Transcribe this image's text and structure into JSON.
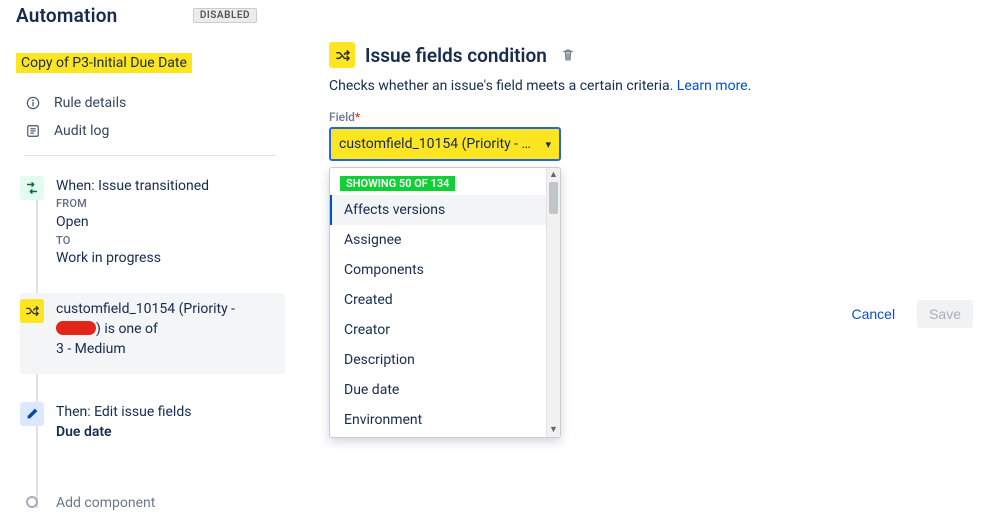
{
  "automation": {
    "page_title": "Automation",
    "status_badge": "DISABLED",
    "rule_name": "Copy of P3-Initial Due Date",
    "nav": {
      "rule_details": "Rule details",
      "audit_log": "Audit log"
    },
    "steps": {
      "trigger": {
        "title": "When: Issue transitioned",
        "from_label": "FROM",
        "from_value": "Open",
        "to_label": "TO",
        "to_value": "Work in progress"
      },
      "condition": {
        "line1_prefix": "customfield_10154 (Priority -",
        "line1_suffix": ") is one of",
        "value": "3 - Medium"
      },
      "action": {
        "title": "Then: Edit issue fields",
        "field": "Due date"
      },
      "add_component": "Add component"
    }
  },
  "panel": {
    "heading": "Issue fields condition",
    "description": "Checks whether an issue's field meets a certain criteria. ",
    "learn_more": "Learn more",
    "field_label": "Field",
    "required_mark": "*",
    "selected_value": "customfield_10154 (Priority - G...",
    "dropdown": {
      "results_header": "SHOWING 50 OF 134",
      "options": [
        "Affects versions",
        "Assignee",
        "Components",
        "Created",
        "Creator",
        "Description",
        "Due date",
        "Environment"
      ]
    },
    "buttons": {
      "cancel": "Cancel",
      "save": "Save"
    }
  },
  "icons": {
    "info": "info-circle-icon",
    "list": "list-icon",
    "transition": "transition-icon",
    "shuffle": "shuffle-icon",
    "pencil": "pencil-icon",
    "trash": "trash-icon",
    "chevron_down": "chevron-down-icon"
  }
}
